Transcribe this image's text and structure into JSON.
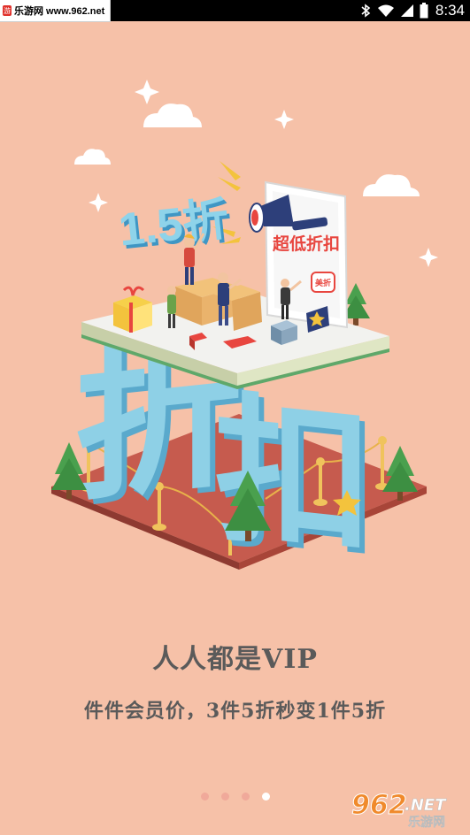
{
  "status_bar": {
    "watermark_text": "乐游网 www.962.net",
    "time": "8:34"
  },
  "illustration": {
    "discount_number": "1.5折",
    "sign_text": "超低折扣",
    "sign_logo_text": "美折",
    "big_characters": "折扣"
  },
  "onboarding": {
    "title": "人人都是VIP",
    "subtitle": "件件会员价，3件5折秒变1件5折",
    "pages": 4,
    "active_page": 4
  },
  "watermark_bottom": {
    "number": "962",
    "suffix": ".NET",
    "name": "乐游网"
  }
}
